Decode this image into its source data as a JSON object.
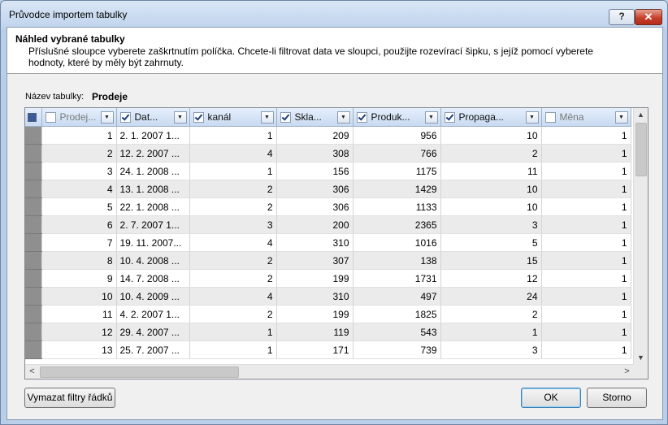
{
  "window": {
    "title": "Průvodce importem tabulky",
    "help_label": "?",
    "close_label": "✕"
  },
  "header": {
    "title": "Náhled vybrané tabulky",
    "description": "Příslušné sloupce vyberete zaškrtnutím políčka. Chcete-li filtrovat data ve sloupci, použijte rozevírací šipku, s jejíž pomocí vyberete hodnoty, které by měly být zahrnuty."
  },
  "table_name": {
    "label": "Název tabulky:",
    "value": "Prodeje"
  },
  "grid": {
    "columns": [
      {
        "label": "Prodej...",
        "checked": false
      },
      {
        "label": "Dat...",
        "checked": true
      },
      {
        "label": "kanál",
        "checked": true
      },
      {
        "label": "Skla...",
        "checked": true
      },
      {
        "label": "Produk...",
        "checked": true
      },
      {
        "label": "Propaga...",
        "checked": true
      },
      {
        "label": "Měna",
        "checked": false
      }
    ],
    "rows": [
      [
        "1",
        "2. 1. 2007 1...",
        "1",
        "209",
        "956",
        "10",
        "1"
      ],
      [
        "2",
        "12. 2. 2007 ...",
        "4",
        "308",
        "766",
        "2",
        "1"
      ],
      [
        "3",
        "24. 1. 2008 ...",
        "1",
        "156",
        "1175",
        "11",
        "1"
      ],
      [
        "4",
        "13. 1. 2008 ...",
        "2",
        "306",
        "1429",
        "10",
        "1"
      ],
      [
        "5",
        "22. 1. 2008 ...",
        "2",
        "306",
        "1133",
        "10",
        "1"
      ],
      [
        "6",
        "2. 7. 2007 1...",
        "3",
        "200",
        "2365",
        "3",
        "1"
      ],
      [
        "7",
        "19. 11. 2007...",
        "4",
        "310",
        "1016",
        "5",
        "1"
      ],
      [
        "8",
        "10. 4. 2008 ...",
        "2",
        "307",
        "138",
        "15",
        "1"
      ],
      [
        "9",
        "14. 7. 2008 ...",
        "2",
        "199",
        "1731",
        "12",
        "1"
      ],
      [
        "10",
        "10. 4. 2009 ...",
        "4",
        "310",
        "497",
        "24",
        "1"
      ],
      [
        "11",
        "4. 2. 2007 1...",
        "2",
        "199",
        "1825",
        "2",
        "1"
      ],
      [
        "12",
        "29. 4. 2007 ...",
        "1",
        "119",
        "543",
        "1",
        "1"
      ],
      [
        "13",
        "25. 7. 2007 ...",
        "1",
        "171",
        "739",
        "3",
        "1"
      ]
    ]
  },
  "buttons": {
    "clear_filters": "Vymazat filtry řádků",
    "ok": "OK",
    "cancel": "Storno"
  },
  "scroll": {
    "left": "<",
    "right": ">",
    "up": "▲",
    "down": "▼"
  }
}
